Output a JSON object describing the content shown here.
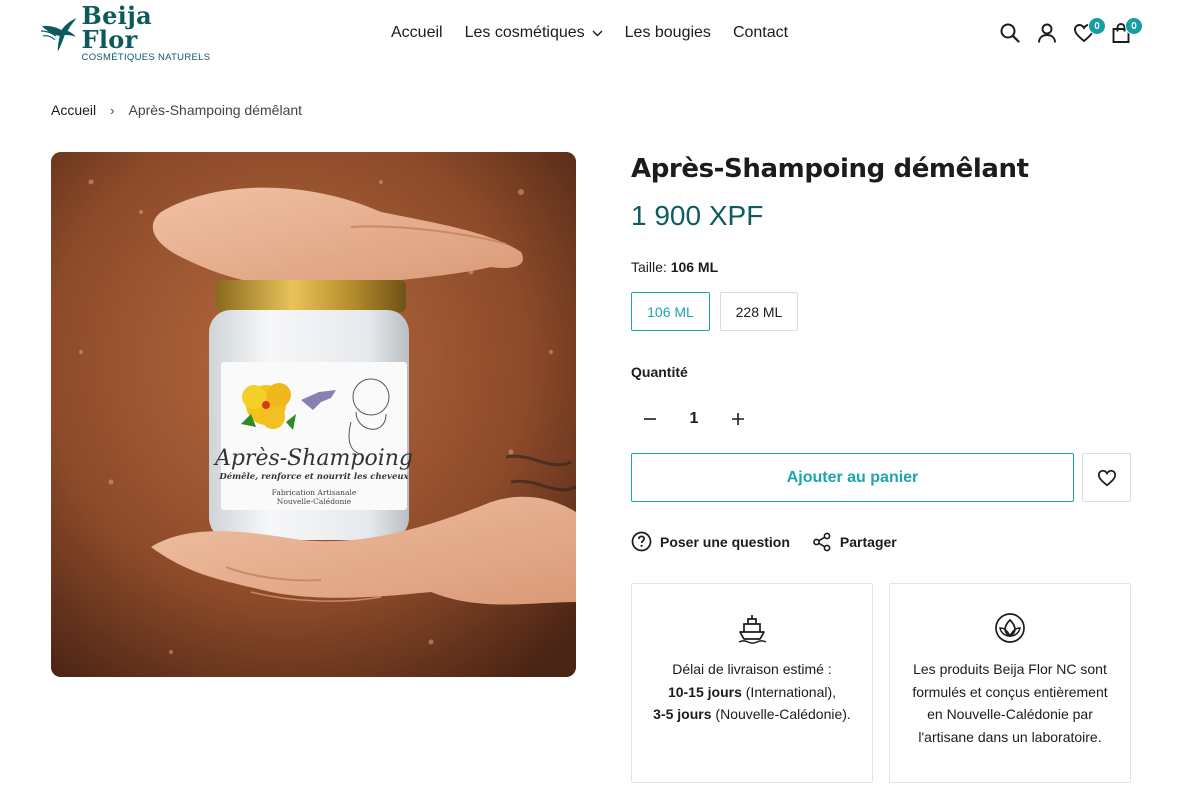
{
  "brand": {
    "name": "Beija Flor",
    "tagline": "COSMÉTIQUES NATURELS",
    "accent": "#169ea5",
    "dark": "#0f5c60"
  },
  "nav": {
    "items": [
      "Accueil",
      "Les cosmétiques",
      "Les bougies",
      "Contact"
    ]
  },
  "header": {
    "wishlist_count": "0",
    "cart_count": "0",
    "icons": [
      "search-icon",
      "account-icon",
      "wishlist-icon",
      "cart-icon"
    ]
  },
  "breadcrumb": {
    "home": "Accueil",
    "separator": "›",
    "current": "Après-Shampoing démêlant"
  },
  "jar_label": {
    "title": "Après-Shampoing",
    "subtitle": "Démêle, renforce et nourrit les cheveux",
    "line1": "Fabrication Artisanale",
    "line2": "Nouvelle-Calédonie"
  },
  "product": {
    "title": "Après-Shampoing démêlant",
    "price": "1 900 XPF",
    "size_label": "Taille:",
    "size_selected": "106 ML",
    "sizes": [
      "106 ML",
      "228 ML"
    ],
    "quantity_label": "Quantité",
    "quantity": "1",
    "add_to_cart": "Ajouter au panier",
    "ask_question": "Poser une question",
    "share": "Partager"
  },
  "delivery_card": {
    "line1": "Délai de livraison estimé :",
    "intl_days": "10-15 jours",
    "intl_text": " (International),",
    "nc_days": "3-5 jours",
    "nc_text": " (Nouvelle-Calédonie)."
  },
  "origin_card": {
    "text": "Les produits Beija Flor NC sont formulés et conçus entièrement en Nouvelle-Calédonie par l'artisane dans un laboratoire."
  }
}
